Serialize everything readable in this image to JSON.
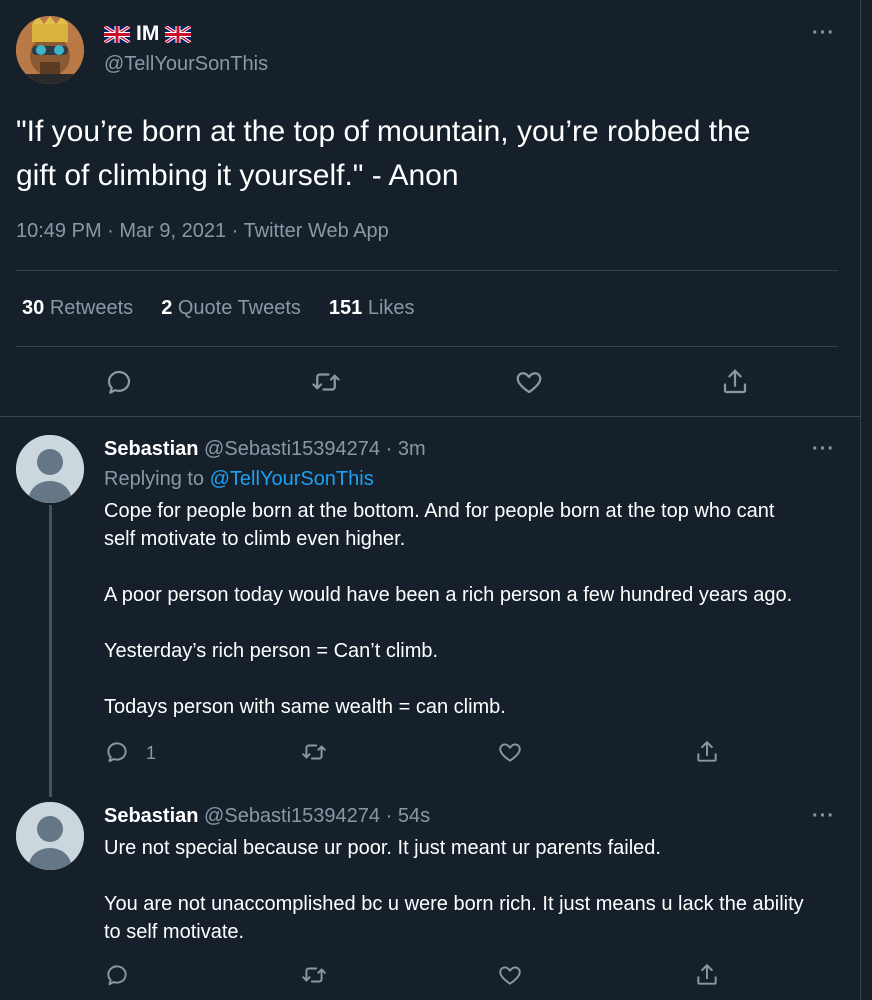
{
  "main_tweet": {
    "display_name": "IM",
    "handle": "@TellYourSonThis",
    "text_line1": "\"If you’re born at the top of mountain, you’re robbed the",
    "text_line2": "gift of climbing it yourself.\" - Anon",
    "meta": "10:49 PM · Mar 9, 2021 · Twitter Web App",
    "stats": {
      "retweets_count": "30",
      "retweets_label": "Retweets",
      "quotes_count": "2",
      "quotes_label": "Quote Tweets",
      "likes_count": "151",
      "likes_label": "Likes"
    }
  },
  "replies": [
    {
      "name": "Sebastian",
      "handle_time": "@Sebasti15394274 · 3m",
      "replying_prefix": "Replying to",
      "replying_to": "@TellYourSonThis",
      "lines": [
        "Cope for people born at the bottom. And for people born at the top who cant",
        "self motivate to climb even higher.",
        "A poor person today would have been a rich person a few hundred years ago.",
        "Yesterday’s rich person = Can’t climb.",
        "Todays person with same wealth = can climb."
      ],
      "reply_count": "1"
    },
    {
      "name": "Sebastian",
      "handle_time": "@Sebasti15394274 · 54s",
      "lines": [
        "Ure not special because ur poor. It just meant ur parents failed.",
        "You are not unaccomplished bc u were born rich. It just means u lack the ability",
        "to self motivate."
      ]
    }
  ],
  "more_label": "···",
  "icons": [
    "reply-icon",
    "retweet-icon",
    "like-icon",
    "share-icon",
    "more-icon",
    "uk-flag-icon",
    "default-avatar-icon"
  ],
  "colors": {
    "background": "#15202b",
    "secondary_text": "#8899a6",
    "link": "#1da1f2",
    "divider": "#38444d"
  }
}
